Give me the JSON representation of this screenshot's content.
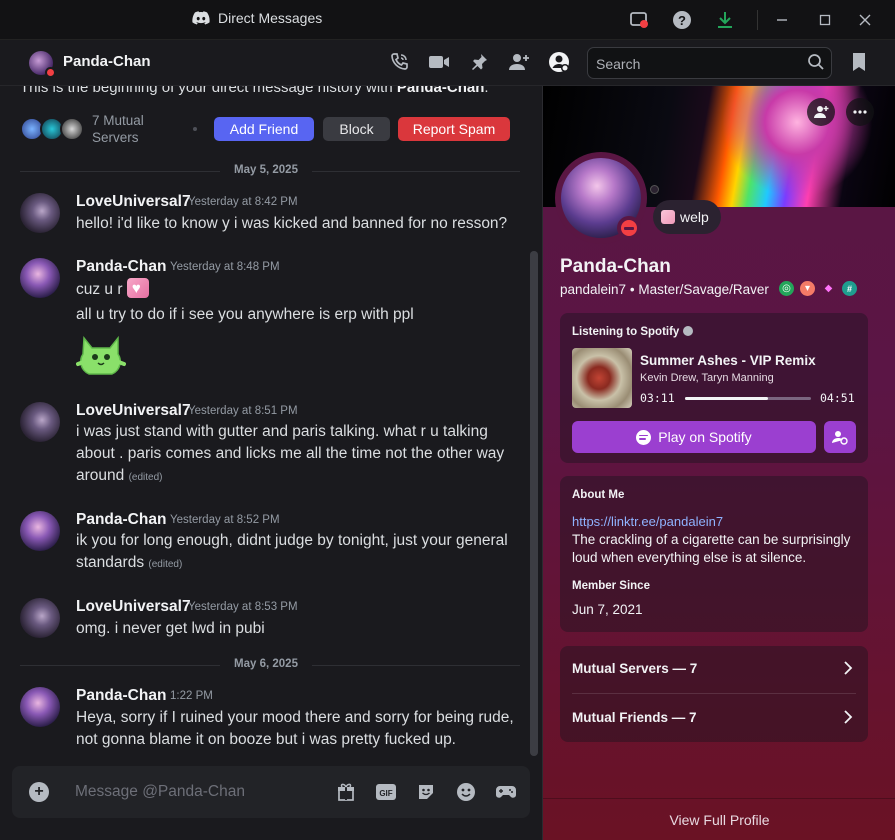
{
  "window": {
    "title": "Direct Messages"
  },
  "header": {
    "name": "Panda-Chan",
    "search_placeholder": "Search"
  },
  "chat": {
    "intro_text": "This is the beginning of your direct message history with ",
    "intro_name": "Panda-Chan",
    "mutual_servers_text": "7 Mutual Servers",
    "add_friend": "Add Friend",
    "block": "Block",
    "report_spam": "Report Spam",
    "dividers": [
      "May 5, 2025",
      "May 6, 2025"
    ],
    "messages": [
      {
        "user": "LoveUniversal7",
        "time": "Yesterday at 8:42 PM",
        "lines": [
          "hello! i'd like to know y i was kicked and banned for no resson?"
        ]
      },
      {
        "user": "Panda-Chan",
        "time": "Yesterday at 8:48 PM",
        "lines": [
          "cuz u r",
          "all u try to do if i see you anywhere is erp with ppl"
        ]
      },
      {
        "user": "LoveUniversal7",
        "time": "Yesterday at 8:51 PM",
        "lines": [
          "i was just stand with gutter and paris talking. what r u talking about . paris comes and licks me all the time not the other way around"
        ]
      },
      {
        "user": "Panda-Chan",
        "time": "Yesterday at 8:52 PM",
        "lines": [
          "ik you for long enough, didnt judge by tonight, just your general standards"
        ]
      },
      {
        "user": "LoveUniversal7",
        "time": "Yesterday at 8:53 PM",
        "lines": [
          "omg. i never get lwd in pubi"
        ]
      },
      {
        "user": "Panda-Chan",
        "time": "1:22 PM",
        "lines": [
          "Heya, sorry if I ruined your mood there and sorry for being rude, not gonna blame it on booze but i was pretty fucked up."
        ]
      }
    ],
    "edited_label": "(edited)",
    "composer_placeholder": "Message @Panda-Chan"
  },
  "profile": {
    "status": "welp",
    "name": "Panda-Chan",
    "username": "pandalein7",
    "pronouns": "Master/Savage/Raver",
    "spotify": {
      "label": "Listening to Spotify",
      "track": "Summer Ashes - VIP Remix",
      "artists": "Kevin Drew, Taryn Manning",
      "elapsed": "03:11",
      "duration": "04:51",
      "progress": 0.655,
      "play_label": "Play on Spotify"
    },
    "about_label": "About Me",
    "about_link": "https://linktr.ee/pandalein7",
    "about_bio": "The crackling of a cigarette can be surprisingly loud when everything else is at silence.",
    "member_since_label": "Member Since",
    "member_since": "Jun 7, 2021",
    "mutual_servers": "Mutual Servers — 7",
    "mutual_friends": "Mutual Friends — 7",
    "view_full": "View Full Profile"
  },
  "colors": {
    "accent": "#5865f2",
    "danger": "#da373c",
    "spotify_btn": "#9b3fd0",
    "dnd": "#f23f43"
  }
}
